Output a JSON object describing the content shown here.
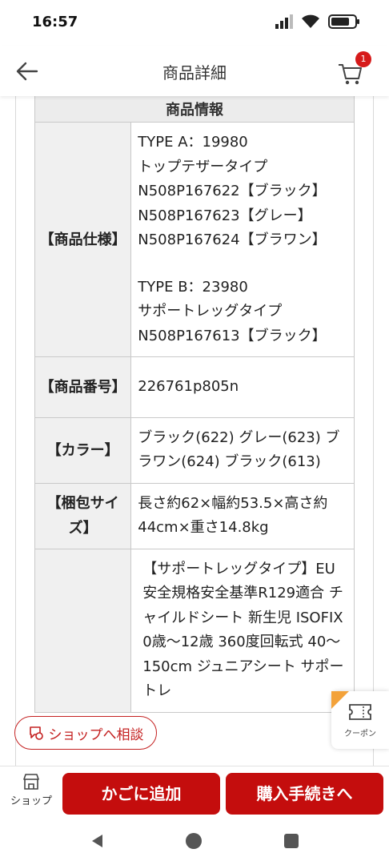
{
  "status_bar": {
    "time": "16:57"
  },
  "header": {
    "title": "商品詳細",
    "cart_badge": "1"
  },
  "spec_table": {
    "heading": "商品情報",
    "rows": [
      {
        "label": "【商品仕様】",
        "lines": [
          "TYPE A：19980",
          "トップテザータイプ",
          "N508P167622【ブラック】",
          "N508P167623【グレー】",
          "N508P167624【ブラワン】",
          "",
          "TYPE B：23980",
          "サポートレッグタイプ",
          "N508P167613【ブラック】"
        ]
      },
      {
        "label": "【商品番号】",
        "value": "226761p805n"
      },
      {
        "label": "【カラー】",
        "value": "ブラック(622) グレー(623) ブラワン(624) ブラック(613)"
      },
      {
        "label": "【梱包サイズ】",
        "value": "長さ約62×幅約53.5×高さ約44cm×重さ14.8kg"
      },
      {
        "label": "",
        "value": "【サポートレッグタイプ】EU安全規格安全基準R129適合 チャイルドシート 新生児 ISOFIX 0歳〜12歳 360度回転式 40〜150cm ジュニアシート サポートレ"
      }
    ]
  },
  "floating": {
    "shop_consult": "ショップへ相談",
    "coupon": "クーポン"
  },
  "bottom_bar": {
    "shop": "ショップ",
    "add_to_cart": "かごに追加",
    "purchase": "購入手続きへ"
  },
  "colors": {
    "accent": "#c40d0d",
    "badge": "#d61a1a",
    "coupon_flag": "#f3a23a"
  },
  "icons": [
    "back-arrow-icon",
    "cart-icon",
    "shop-icon",
    "chat-icon",
    "coupon-icon",
    "nav-back-icon",
    "nav-home-icon",
    "nav-recent-icon"
  ]
}
